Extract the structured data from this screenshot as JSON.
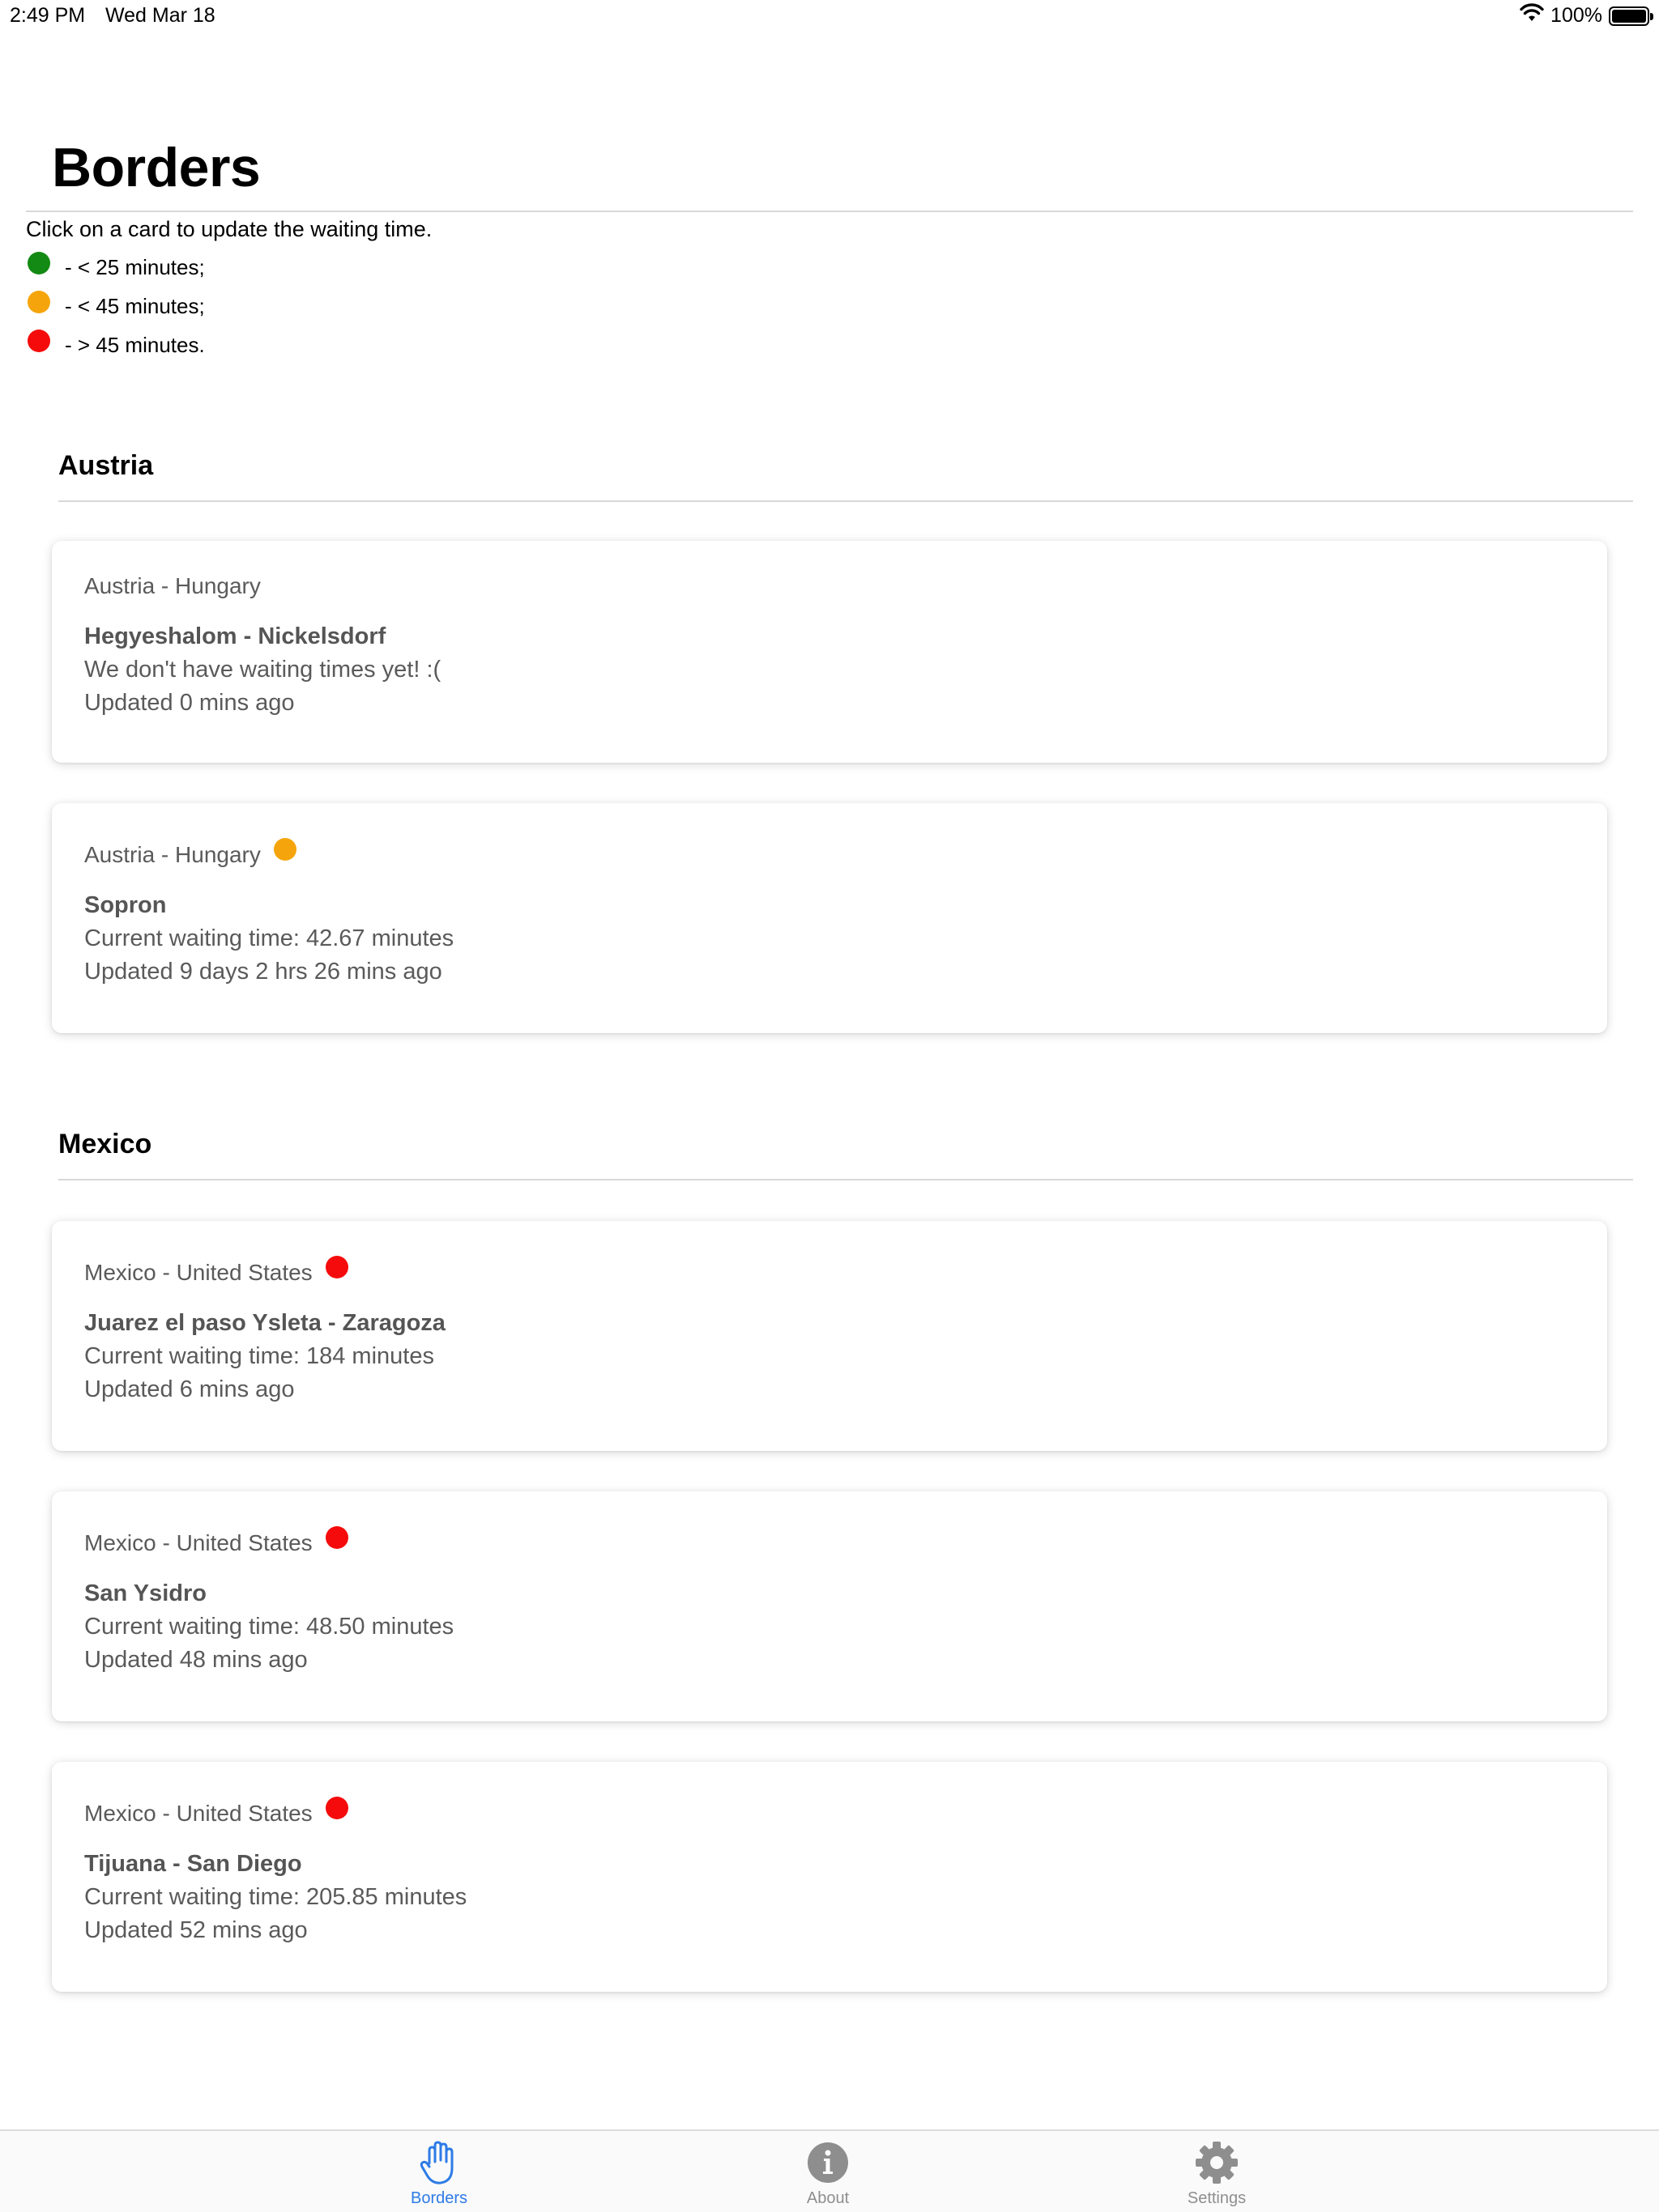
{
  "status_bar": {
    "time": "2:49 PM",
    "date": "Wed Mar 18",
    "battery": "100%"
  },
  "header": {
    "title": "Borders",
    "instructions": "Click on a card to update the waiting time."
  },
  "legend": [
    {
      "color": "green",
      "label": "- < 25 minutes;"
    },
    {
      "color": "orange",
      "label": "- < 45 minutes;"
    },
    {
      "color": "red",
      "label": "- > 45 minutes."
    }
  ],
  "colors": {
    "green": "#138a13",
    "orange": "#f5a50b",
    "red": "#f50b0b",
    "accent": "#2e7be6"
  },
  "sections": [
    {
      "title": "Austria",
      "cards": [
        {
          "route": "Austria - Hungary",
          "status": null,
          "name": "Hegyeshalom - Nickelsdorf",
          "waiting": "We don't have waiting times yet! :(",
          "updated": "Updated 0 mins ago"
        },
        {
          "route": "Austria - Hungary",
          "status": "orange",
          "name": "Sopron",
          "waiting": "Current waiting time: 42.67 minutes",
          "updated": "Updated 9 days 2 hrs 26 mins ago"
        }
      ]
    },
    {
      "title": "Mexico",
      "cards": [
        {
          "route": "Mexico - United States",
          "status": "red",
          "name": "Juarez el paso Ysleta - Zaragoza",
          "waiting": "Current waiting time: 184 minutes",
          "updated": "Updated 6 mins ago"
        },
        {
          "route": "Mexico - United States",
          "status": "red",
          "name": "San Ysidro",
          "waiting": "Current waiting time: 48.50 minutes",
          "updated": "Updated 48 mins ago"
        },
        {
          "route": "Mexico - United States",
          "status": "red",
          "name": "Tijuana - San Diego",
          "waiting": "Current waiting time: 205.85 minutes",
          "updated": "Updated 52 mins ago"
        }
      ]
    }
  ],
  "tab_bar": {
    "tabs": [
      {
        "label": "Borders",
        "icon": "hand-icon",
        "active": true
      },
      {
        "label": "About",
        "icon": "info-icon",
        "active": false
      },
      {
        "label": "Settings",
        "icon": "gear-icon",
        "active": false
      }
    ]
  }
}
